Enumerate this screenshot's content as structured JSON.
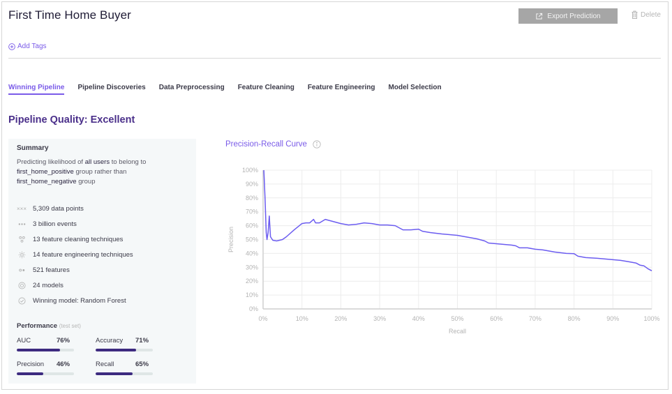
{
  "header": {
    "title": "First Time Home Buyer",
    "export_label": "Export Prediction",
    "delete_label": "Delete",
    "add_tags_label": "Add Tags"
  },
  "tabs": [
    {
      "label": "Winning Pipeline",
      "active": true
    },
    {
      "label": "Pipeline Discoveries",
      "active": false
    },
    {
      "label": "Data Preprocessing",
      "active": false
    },
    {
      "label": "Feature Cleaning",
      "active": false
    },
    {
      "label": "Feature Engineering",
      "active": false
    },
    {
      "label": "Model Selection",
      "active": false
    }
  ],
  "quality": "Pipeline Quality: Excellent",
  "summary": {
    "heading": "Summary",
    "description": {
      "p1": "Predicting likelihood of ",
      "b1": "all users",
      "p2": " to belong to ",
      "b2": "first_home_positive",
      "p3": " group rather than ",
      "b3": "first_home_negative",
      "p4": " group"
    },
    "stats": [
      {
        "icon": "data-points-icon",
        "text": "5,309 data points"
      },
      {
        "icon": "events-icon",
        "text": "3 billion events"
      },
      {
        "icon": "cleaning-icon",
        "text": "13 feature cleaning techniques"
      },
      {
        "icon": "gear-icon",
        "text": "14 feature engineering techniques"
      },
      {
        "icon": "features-icon",
        "text": "521 features"
      },
      {
        "icon": "models-icon",
        "text": "24 models"
      },
      {
        "icon": "check-circle-icon",
        "text": "Winning model: Random Forest"
      }
    ],
    "performance": {
      "title": "Performance",
      "subtitle": "(test set)",
      "metrics": [
        {
          "label": "AUC",
          "value": "76%",
          "fraction": 0.76
        },
        {
          "label": "Accuracy",
          "value": "71%",
          "fraction": 0.71
        },
        {
          "label": "Precision",
          "value": "46%",
          "fraction": 0.46
        },
        {
          "label": "Recall",
          "value": "65%",
          "fraction": 0.65
        }
      ]
    }
  },
  "colors": {
    "accent": "#7a5be8",
    "quality": "#4a2f8a",
    "bar_fill": "#3d2b80",
    "curve": "#6b5cf0"
  },
  "chart_data": {
    "type": "line",
    "title": "Precision-Recall Curve",
    "xlabel": "Recall",
    "ylabel": "Precision",
    "xlim": [
      0,
      100
    ],
    "ylim": [
      0,
      100
    ],
    "grid": true,
    "xticks": [
      "0%",
      "10%",
      "20%",
      "30%",
      "40%",
      "50%",
      "60%",
      "70%",
      "80%",
      "90%",
      "100%"
    ],
    "yticks": [
      "0%",
      "10%",
      "20%",
      "30%",
      "40%",
      "50%",
      "60%",
      "70%",
      "80%",
      "90%",
      "100%"
    ],
    "series": [
      {
        "name": "Precision-Recall",
        "x": [
          0.2,
          0.5,
          0.8,
          1.0,
          1.3,
          1.6,
          1.9,
          2.5,
          3.5,
          5,
          6,
          8,
          10,
          11,
          12,
          13,
          13.5,
          14.5,
          16,
          18,
          20,
          22,
          24,
          26,
          28,
          30,
          32,
          34,
          35,
          36,
          38,
          40,
          41,
          43,
          46,
          50,
          52,
          55,
          57,
          58,
          60,
          62,
          64,
          65,
          66,
          68,
          70,
          72,
          73,
          75,
          78,
          80,
          81,
          83,
          86,
          88,
          90,
          92,
          94,
          96,
          97,
          98,
          99,
          100
        ],
        "y": [
          100,
          80,
          55,
          50,
          55,
          67,
          52,
          49.5,
          49,
          50,
          52,
          57,
          61.5,
          62,
          62,
          64.5,
          62,
          62,
          64.5,
          63,
          61.5,
          60.5,
          61,
          62,
          61.5,
          60.5,
          60.5,
          60,
          58.5,
          57,
          57,
          57.5,
          56,
          55,
          54,
          53,
          52,
          50.5,
          49,
          47.5,
          47,
          46.5,
          46,
          45.5,
          44,
          44,
          43,
          42.5,
          42,
          41,
          40,
          39.8,
          38,
          37,
          36.5,
          36,
          35.5,
          35,
          34,
          33,
          31.5,
          31,
          29,
          27.5
        ]
      }
    ]
  }
}
